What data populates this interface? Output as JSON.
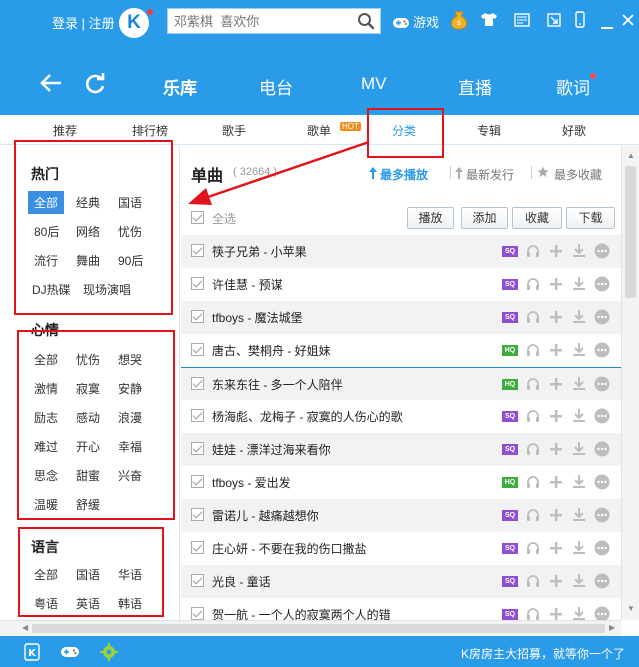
{
  "header": {
    "login": "登录",
    "separator": "|",
    "register": "注册",
    "logo_letter": "K",
    "search_placeholder": "邓紫棋  喜欢你",
    "games_label": "游戏"
  },
  "nav": {
    "items": [
      {
        "label": "乐库",
        "active": true
      },
      {
        "label": "电台"
      },
      {
        "label": "MV"
      },
      {
        "label": "直播"
      },
      {
        "label": "歌词"
      }
    ]
  },
  "subnav": {
    "tabs": [
      "推荐",
      "排行榜",
      "歌手",
      "歌单",
      "分类",
      "专辑",
      "好歌"
    ],
    "hot_badge": "HOT",
    "active_tab": "分类"
  },
  "sidebar": {
    "sections": [
      {
        "title": "热门",
        "tags": [
          "全部",
          "经典",
          "国语",
          "80后",
          "网络",
          "忧伤",
          "流行",
          "舞曲",
          "90后",
          "DJ热碟",
          "现场演唱"
        ]
      },
      {
        "title": "心情",
        "tags": [
          "全部",
          "忧伤",
          "想哭",
          "激情",
          "寂寞",
          "安静",
          "励志",
          "感动",
          "浪漫",
          "难过",
          "开心",
          "幸福",
          "思念",
          "甜蜜",
          "兴奋",
          "温暖",
          "舒缓"
        ]
      },
      {
        "title": "语言",
        "tags": [
          "全部",
          "国语",
          "华语",
          "粤语",
          "英语",
          "韩语"
        ]
      }
    ],
    "selected_tag": "全部"
  },
  "main": {
    "title": "单曲",
    "count": "( 32664 )",
    "sort": {
      "active": "最多播放",
      "option2": "最新发行",
      "option3": "最多收藏"
    },
    "select_all": "全选",
    "actions": [
      "播放",
      "添加",
      "收藏",
      "下载"
    ],
    "songs": [
      {
        "title": "筷子兄弟  - 小苹果",
        "quality": "SQ"
      },
      {
        "title": "许佳慧  - 预谋",
        "quality": "SQ"
      },
      {
        "title": "tfboys  - 魔法城堡",
        "quality": "SQ"
      },
      {
        "title": "唐古、樊桐舟  - 好姐妹",
        "quality": "HQ"
      },
      {
        "title": "东来东往  - 多一个人陪伴",
        "quality": "HQ"
      },
      {
        "title": "杨海彪、龙梅子  - 寂寞的人伤心的歌",
        "quality": "SQ"
      },
      {
        "title": "娃娃  - 漂洋过海来看你",
        "quality": "SQ"
      },
      {
        "title": "tfboys  - 爱出发",
        "quality": "HQ"
      },
      {
        "title": "雷诺儿  - 越痛越想你",
        "quality": "SQ"
      },
      {
        "title": "庄心妍  - 不要在我的伤口撒盐",
        "quality": "SQ"
      },
      {
        "title": "光良  - 童话",
        "quality": "SQ"
      },
      {
        "title": "贺一航  - 一个人的寂寞两个人的错",
        "quality": "SQ"
      }
    ]
  },
  "footer": {
    "message": "K房房主大招募，就等你一个了"
  },
  "colors": {
    "brand": "#2a9be8",
    "highlight": "#e2131b",
    "sq": "#8e4fd1",
    "hq": "#3eac3e"
  }
}
